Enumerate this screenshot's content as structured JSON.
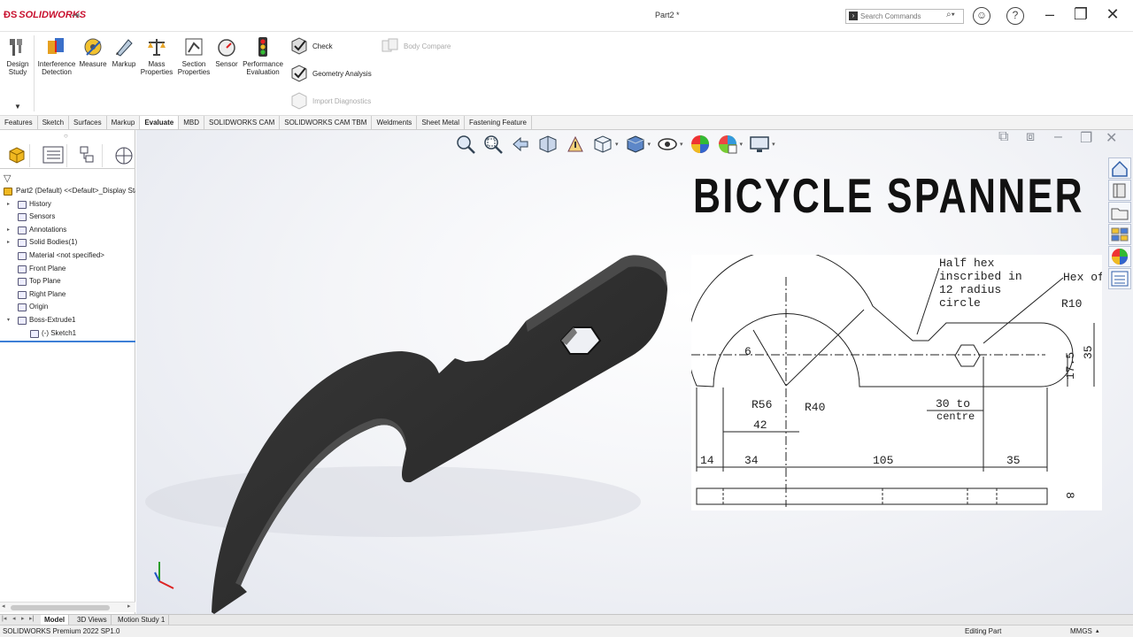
{
  "app": {
    "logo_text": "SOLIDWORKS",
    "document_title": "Part2 *"
  },
  "search": {
    "placeholder": "Search Commands"
  },
  "ribbon": {
    "design_study": "Design Study",
    "interference_detection": "Interference Detection",
    "measure": "Measure",
    "markup": "Markup",
    "mass_properties": "Mass Properties",
    "section_properties": "Section Properties",
    "sensor": "Sensor",
    "performance_evaluation": "Performance Evaluation",
    "check": "Check",
    "geometry_analysis": "Geometry Analysis",
    "import_diagnostics": "Import Diagnostics",
    "body_compare": "Body Compare"
  },
  "tabs": [
    "Features",
    "Sketch",
    "Surfaces",
    "Markup",
    "Evaluate",
    "MBD",
    "SOLIDWORKS CAM",
    "SOLIDWORKS CAM TBM",
    "Weldments",
    "Sheet Metal",
    "Fastening Feature"
  ],
  "active_tab": "Evaluate",
  "tree": {
    "root": "Part2 (Default) <<Default>_Display Sta",
    "items": [
      {
        "label": "History",
        "icon": "history-icon",
        "expandable": true,
        "indent": 0
      },
      {
        "label": "Sensors",
        "icon": "sensors-icon",
        "expandable": false,
        "indent": 0
      },
      {
        "label": "Annotations",
        "icon": "annotations-icon",
        "expandable": true,
        "indent": 0
      },
      {
        "label": "Solid Bodies(1)",
        "icon": "solid-bodies-icon",
        "expandable": true,
        "indent": 0
      },
      {
        "label": "Material <not specified>",
        "icon": "material-icon",
        "expandable": false,
        "indent": 0
      },
      {
        "label": "Front Plane",
        "icon": "plane-icon",
        "expandable": false,
        "indent": 0
      },
      {
        "label": "Top Plane",
        "icon": "plane-icon",
        "expandable": false,
        "indent": 0
      },
      {
        "label": "Right Plane",
        "icon": "plane-icon",
        "expandable": false,
        "indent": 0
      },
      {
        "label": "Origin",
        "icon": "origin-icon",
        "expandable": false,
        "indent": 0
      },
      {
        "label": "Boss-Extrude1",
        "icon": "extrude-icon",
        "expandable": true,
        "expanded": true,
        "indent": 0
      },
      {
        "label": "(-) Sketch1",
        "icon": "sketch-icon",
        "expandable": false,
        "indent": 1
      }
    ]
  },
  "overlay": {
    "heading": "BICYCLE SPANNER"
  },
  "drawing": {
    "notes": {
      "half_hex": [
        "Half hex",
        "inscribed in",
        "12 radius",
        "circle"
      ],
      "hex_of": "Hex of",
      "centre": [
        "30 to",
        "centre"
      ]
    },
    "dims": {
      "r10": "R10",
      "six": "6",
      "r56": "R56",
      "r40": "R40",
      "d42": "42",
      "d17_5": "17.5",
      "d35v": "35",
      "d14": "14",
      "d34": "34",
      "d105": "105",
      "d35h": "35",
      "thk": "8"
    }
  },
  "bottom_tabs": [
    "Model",
    "3D Views",
    "Motion Study 1"
  ],
  "active_bottom_tab": "Model",
  "status": {
    "left": "SOLIDWORKS Premium 2022 SP1.0",
    "mode": "Editing Part",
    "units": "MMGS"
  },
  "colors": {
    "accent": "#3d7fd6",
    "brand": "#c8102e",
    "model": "#2b2b2b"
  }
}
